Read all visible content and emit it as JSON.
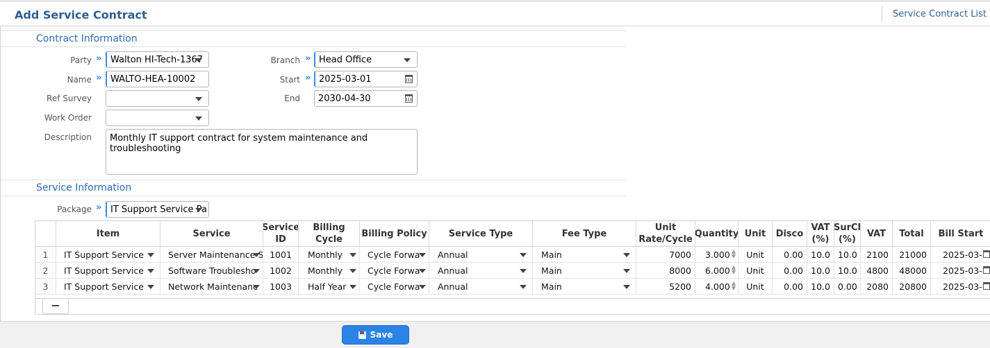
{
  "header": {
    "title": "Add Service Contract",
    "list_link": "Service Contract List"
  },
  "contract": {
    "section_title": "Contract Information",
    "party": {
      "label": "Party",
      "value": "Walton HI-Tech-1367"
    },
    "name": {
      "label": "Name",
      "value": "WALTO-HEA-10002"
    },
    "ref_survey": {
      "label": "Ref Survey",
      "value": ""
    },
    "work_order": {
      "label": "Work Order",
      "value": ""
    },
    "description": {
      "label": "Description",
      "value": "Monthly IT support contract for system maintenance and troubleshooting"
    },
    "branch": {
      "label": "Branch",
      "value": "Head Office"
    },
    "start": {
      "label": "Start",
      "value": "2025-03-01"
    },
    "end": {
      "label": "End",
      "value": "2030-04-30"
    }
  },
  "service": {
    "section_title": "Service Information",
    "package": {
      "label": "Package",
      "value": "IT Support Service Pa"
    }
  },
  "grid": {
    "headers": [
      "",
      "Item",
      "Service",
      "Service ID",
      "Billing Cycle",
      "Billing Policy",
      "Service Type",
      "Fee Type",
      "Unit Rate/Cycle",
      "Quantity",
      "Unit",
      "Disco",
      "VAT (%)",
      "SurCl (%)",
      "VAT",
      "Total",
      "Bill Start"
    ],
    "rows": [
      [
        "1",
        "IT Support Service",
        "Server Maintenance S",
        "1001",
        "Monthly",
        "Cycle Forwa",
        "Annual",
        "Main",
        "7000",
        "3.000",
        "Unit",
        "0.00",
        "10.0",
        "10.0",
        "2100",
        "21000",
        "2025-03-"
      ],
      [
        "2",
        "IT Support Service",
        "Software Troublesho",
        "1002",
        "Monthly",
        "Cycle Forwa",
        "Annual",
        "Main",
        "8000",
        "6.000",
        "Unit",
        "0.00",
        "10.0",
        "10.0",
        "4800",
        "48000",
        "2025-03-"
      ],
      [
        "3",
        "IT Support Service",
        "Network Maintenanc",
        "1003",
        "Half Year",
        "Cycle Forwa",
        "Annual",
        "Main",
        "5200",
        "4.000",
        "Unit",
        "0.00",
        "10.0",
        "0.00",
        "2080",
        "20800",
        "2025-03-"
      ]
    ],
    "delete_label": "−"
  },
  "footer": {
    "save_label": "Save"
  },
  "colors": {
    "accent": "#2b83e6",
    "title": "#2e5f93",
    "required": "#3a8be0"
  }
}
